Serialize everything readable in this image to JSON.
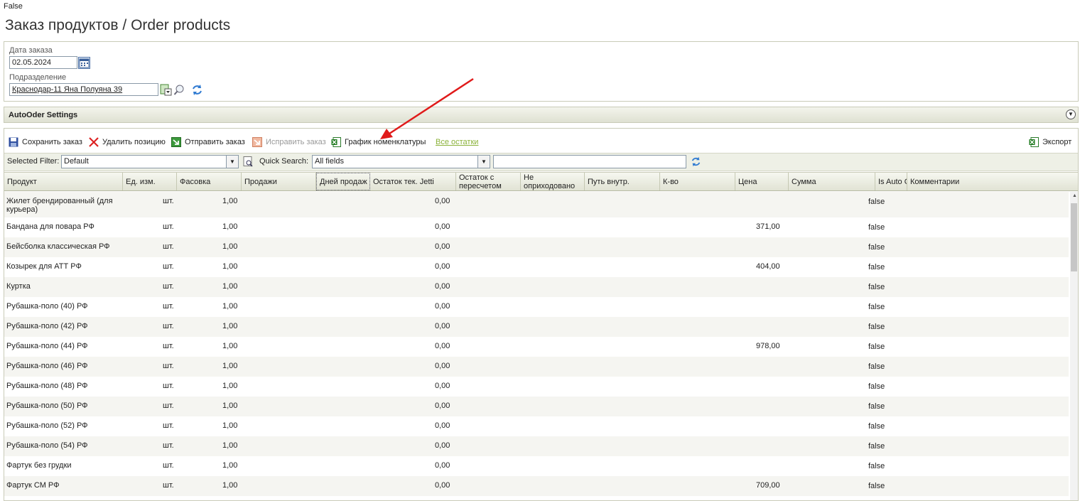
{
  "top_flag": "False",
  "page_title": "Заказ продуктов / Order products",
  "form": {
    "date_label": "Дата заказа",
    "date_value": "02.05.2024",
    "division_label": "Подразделение",
    "division_value": "Краснодар-11 Яна Полуяна 39"
  },
  "settings_title": "AutoOder Settings",
  "toolbar": {
    "save": "Сохранить заказ",
    "delete": "Удалить позицию",
    "send": "Отправить заказ",
    "fix": "Исправить заказ",
    "schedule": "График номенклатуры",
    "all_stock": "Все остатки",
    "export": "Экспорт"
  },
  "filter": {
    "selected_filter_label": "Selected Filter:",
    "selected_filter_value": "Default",
    "quick_search_label": "Quick Search:",
    "quick_search_field": "All fields",
    "quick_search_value": ""
  },
  "columns": [
    "Продукт",
    "Ед. изм.",
    "Фасовка",
    "Продажи",
    "Дней продаж",
    "Остаток тек. Jetti",
    "Остаток с пересчетом",
    "Не оприходовано",
    "Путь внутр.",
    "К-во",
    "Цена",
    "Сумма",
    "Is Auto O",
    "Комментарии"
  ],
  "rows": [
    {
      "product": "Жилет брендированный (для курьера)",
      "unit": "шт.",
      "pack": "1,00",
      "stock": "0,00",
      "price": "",
      "auto": "false"
    },
    {
      "product": "Бандана для повара РФ",
      "unit": "шт.",
      "pack": "1,00",
      "stock": "0,00",
      "price": "371,00",
      "auto": "false"
    },
    {
      "product": "Бейсболка классическая РФ",
      "unit": "шт.",
      "pack": "1,00",
      "stock": "0,00",
      "price": "",
      "auto": "false"
    },
    {
      "product": "Козырек для АТТ РФ",
      "unit": "шт.",
      "pack": "1,00",
      "stock": "0,00",
      "price": "404,00",
      "auto": "false"
    },
    {
      "product": "Куртка",
      "unit": "шт.",
      "pack": "1,00",
      "stock": "0,00",
      "price": "",
      "auto": "false"
    },
    {
      "product": "Рубашка-поло (40) РФ",
      "unit": "шт.",
      "pack": "1,00",
      "stock": "0,00",
      "price": "",
      "auto": "false"
    },
    {
      "product": "Рубашка-поло (42) РФ",
      "unit": "шт.",
      "pack": "1,00",
      "stock": "0,00",
      "price": "",
      "auto": "false"
    },
    {
      "product": "Рубашка-поло (44) РФ",
      "unit": "шт.",
      "pack": "1,00",
      "stock": "0,00",
      "price": "978,00",
      "auto": "false"
    },
    {
      "product": "Рубашка-поло (46) РФ",
      "unit": "шт.",
      "pack": "1,00",
      "stock": "0,00",
      "price": "",
      "auto": "false"
    },
    {
      "product": "Рубашка-поло (48) РФ",
      "unit": "шт.",
      "pack": "1,00",
      "stock": "0,00",
      "price": "",
      "auto": "false"
    },
    {
      "product": "Рубашка-поло (50) РФ",
      "unit": "шт.",
      "pack": "1,00",
      "stock": "0,00",
      "price": "",
      "auto": "false"
    },
    {
      "product": "Рубашка-поло (52) РФ",
      "unit": "шт.",
      "pack": "1,00",
      "stock": "0,00",
      "price": "",
      "auto": "false"
    },
    {
      "product": "Рубашка-поло (54) РФ",
      "unit": "шт.",
      "pack": "1,00",
      "stock": "0,00",
      "price": "",
      "auto": "false"
    },
    {
      "product": "Фартук без грудки",
      "unit": "шт.",
      "pack": "1,00",
      "stock": "0,00",
      "price": "",
      "auto": "false"
    },
    {
      "product": "Фартук СМ РФ",
      "unit": "шт.",
      "pack": "1,00",
      "stock": "0,00",
      "price": "709,00",
      "auto": "false"
    }
  ]
}
